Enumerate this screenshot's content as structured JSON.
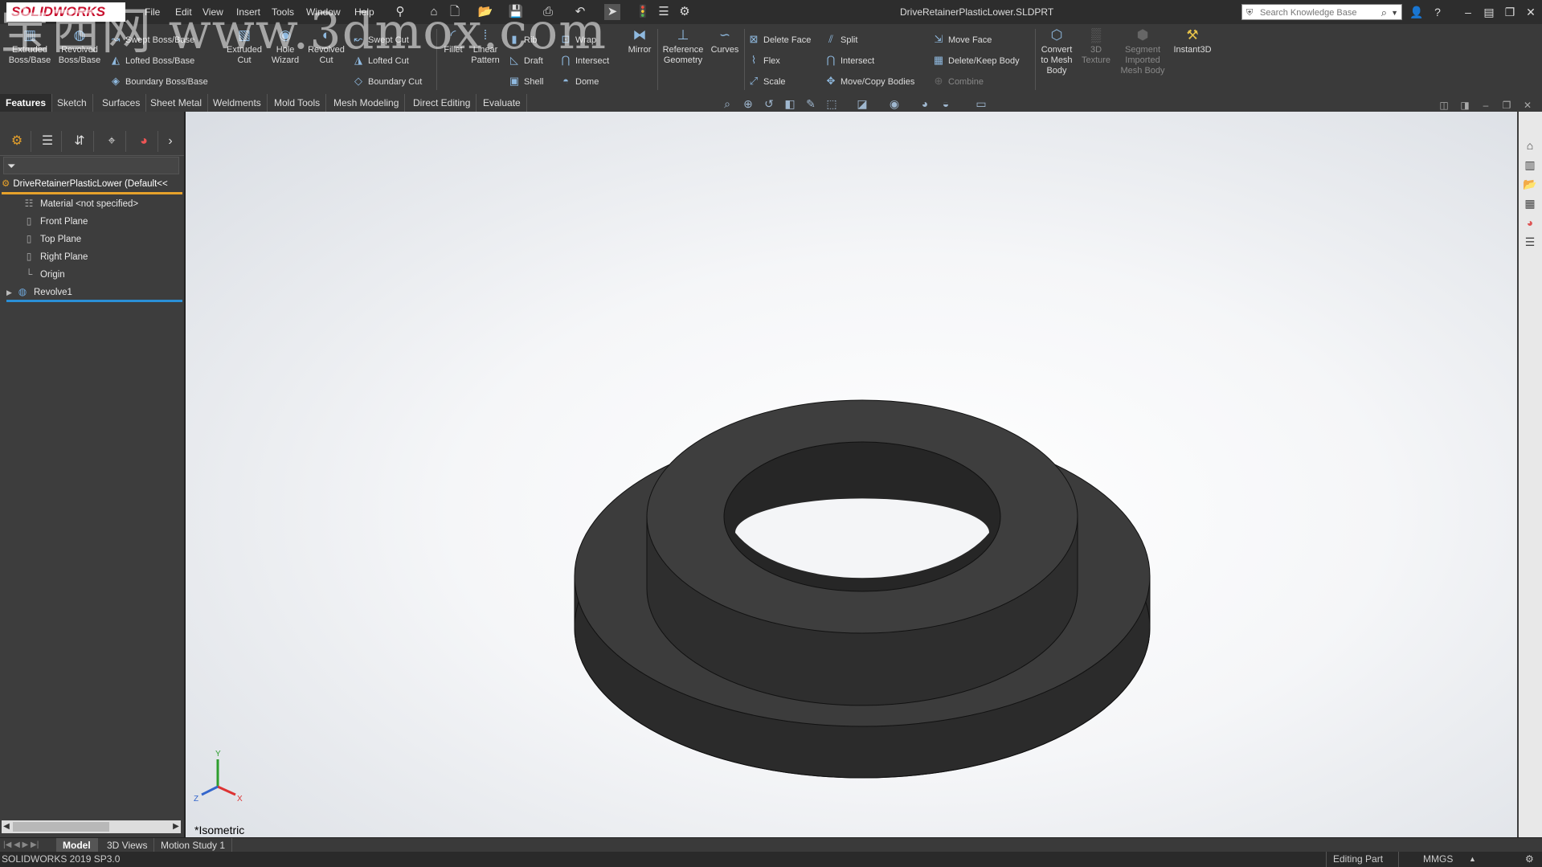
{
  "app": {
    "logo_text": "SOLIDWORKS",
    "doc_title": "DriveRetainerPlasticLower.SLDPRT"
  },
  "menu": [
    "File",
    "Edit",
    "View",
    "Insert",
    "Tools",
    "Window",
    "Help"
  ],
  "search": {
    "placeholder": "Search Knowledge Base"
  },
  "ribbon": {
    "extruded_boss": "Extruded Boss/Base",
    "revolved_boss": "Revolved Boss/Base",
    "swept_boss": "Swept Boss/Base",
    "lofted_boss": "Lofted Boss/Base",
    "boundary_boss": "Boundary Boss/Base",
    "extruded_cut": "Extruded Cut",
    "hole_wizard": "Hole Wizard",
    "revolved_cut": "Revolved Cut",
    "swept_cut": "Swept Cut",
    "lofted_cut": "Lofted Cut",
    "boundary_cut": "Boundary Cut",
    "fillet": "Fillet",
    "linear_pattern": "Linear Pattern",
    "rib": "Rib",
    "wrap": "Wrap",
    "draft": "Draft",
    "intersect": "Intersect",
    "shell": "Shell",
    "dome": "Dome",
    "mirror": "Mirror",
    "reference_geometry": "Reference Geometry",
    "curves": "Curves",
    "delete_face": "Delete Face",
    "split": "Split",
    "move_face": "Move Face",
    "flex": "Flex",
    "intersect2": "Intersect",
    "delete_keep_body": "Delete/Keep Body",
    "scale": "Scale",
    "move_copy_bodies": "Move/Copy Bodies",
    "combine": "Combine",
    "convert_to_mesh": "Convert to Mesh Body",
    "texture_3d": "3D Texture",
    "segment_mesh": "Segment Imported Mesh Body",
    "instant3d": "Instant3D"
  },
  "tabs": [
    "Features",
    "Sketch",
    "Surfaces",
    "Sheet Metal",
    "Weldments",
    "Mold Tools",
    "Mesh Modeling",
    "Direct Editing",
    "Evaluate"
  ],
  "tree": {
    "root": "DriveRetainerPlasticLower  (Default<<",
    "items": [
      "Material <not specified>",
      "Front Plane",
      "Top Plane",
      "Right Plane",
      "Origin",
      "Revolve1"
    ]
  },
  "viewport": {
    "view_name": "*Isometric",
    "part_color": "#3c3c3c"
  },
  "bottom_tabs": [
    "Model",
    "3D Views",
    "Motion Study 1"
  ],
  "status": {
    "version": "SOLIDWORKS 2019 SP3.0",
    "mode": "Editing Part",
    "units": "MMGS"
  },
  "watermark": "宝西网 www.3dmox.com",
  "icons": {
    "search": "search-icon",
    "home": "home-icon",
    "new": "new-document-icon",
    "open": "open-icon",
    "save": "save-icon",
    "print": "print-icon",
    "select": "select-arrow-icon",
    "rebuild": "rebuild-icon",
    "options": "gear-icon"
  },
  "colors": {
    "accent": "#e6a12b",
    "selection": "#2a8fd6",
    "ribbon_icon": "#8fb9df"
  }
}
